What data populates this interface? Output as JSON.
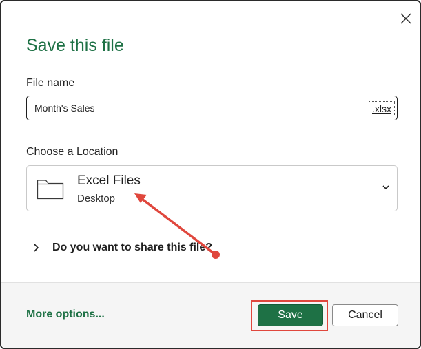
{
  "dialog": {
    "title": "Save this file",
    "close_icon": "close-icon"
  },
  "file_name": {
    "label": "File name",
    "value": "Month's Sales",
    "extension": ".xlsx"
  },
  "location": {
    "label": "Choose a Location",
    "folder_icon": "folder-icon",
    "name": "Excel Files",
    "path": "Desktop",
    "dropdown_icon": "chevron-down-icon"
  },
  "share": {
    "label": "Do you want to share this file?",
    "expand_icon": "chevron-right-icon"
  },
  "footer": {
    "more_options": "More options...",
    "save_label": "Save",
    "cancel_label": "Cancel"
  },
  "colors": {
    "accent_green": "#1e7145",
    "annotation_red": "#e0473d"
  }
}
